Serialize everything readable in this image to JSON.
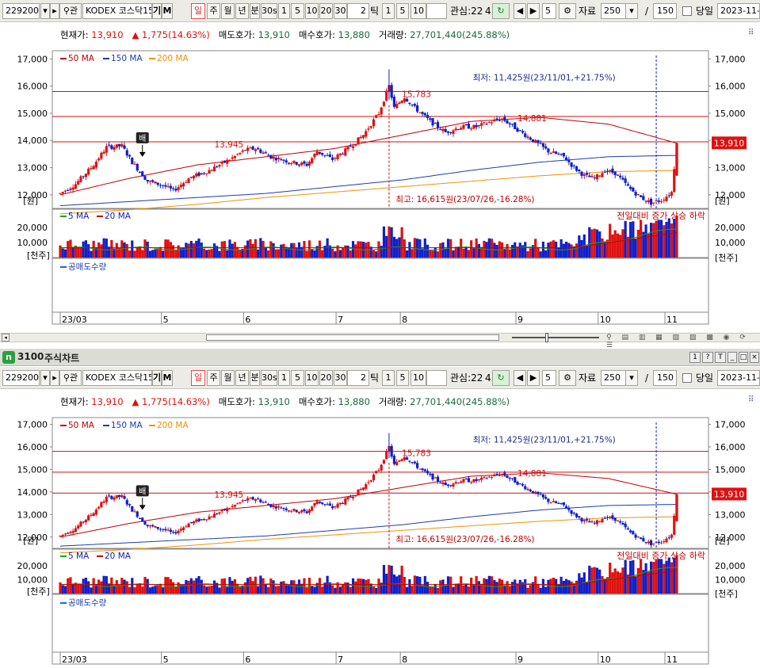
{
  "window": {
    "number": "3100",
    "title": "주식차트"
  },
  "toolbar": {
    "code": "229200",
    "search_icon": "search-icon",
    "name": "KODEX 코스닥15",
    "btn_gi": "기",
    "btn_m": "M",
    "btn_fav": "관",
    "periods": [
      "일",
      "주",
      "월",
      "년",
      "분",
      "30s",
      "1",
      "5",
      "10",
      "20",
      "30"
    ],
    "tick_value": "2",
    "tick_label": "틱",
    "tick_units": [
      "1",
      "5",
      "10"
    ],
    "interest_label": "관심:22",
    "interest_value": "4",
    "step_value": "5",
    "data_label": "자료",
    "data_count": "250",
    "slash": "/",
    "max_count": "150",
    "today_label": "당일",
    "date": "2023-11-0"
  },
  "info": {
    "price_label": "현재가:",
    "price": "13,910",
    "change": "1,775(14.63%)",
    "ask_label": "매도호가:",
    "ask": "13,910",
    "bid_label": "매수호가:",
    "bid": "13,880",
    "volume_label": "거래량:",
    "volume": "27,701,440(245.88%)"
  },
  "legend": {
    "ma50": "50 MA",
    "ma150": "150 MA",
    "ma200": "200 MA",
    "vol_ma5": "5 MA",
    "vol_ma20": "20 MA",
    "short_sell": "공매도수량",
    "prev_compare": "전일대비 증가 상승 하락"
  },
  "annotations": {
    "low": "최저: 11,425원(23/11/01,+21.75%)",
    "high": "최고: 16,615원(23/07/26,-16.28%)",
    "lbl_15783": "15,783",
    "lbl_14881": "14,881",
    "lbl_13945": "13,945",
    "badge": "배",
    "current_tag": "13,910",
    "unit_won": "[원]",
    "unit_vol": "[천주]"
  },
  "price_axis": [
    "17,000",
    "16,000",
    "15,000",
    "14,000",
    "13,000",
    "12,000"
  ],
  "volume_axis": [
    "20,000",
    "10,000"
  ],
  "x_axis": [
    "23/03",
    "5",
    "6",
    "7",
    "8",
    "9",
    "10",
    "11"
  ],
  "colors": {
    "up": "#e01010",
    "down": "#1020c8",
    "ma50": "#c00000",
    "ma150": "#1a3cb0",
    "ma200": "#f09000",
    "vol_ma5": "#20a020",
    "hline": "#d01010"
  },
  "chart_data": {
    "type": "line",
    "series": [
      {
        "name": "50 MA",
        "values": [
          12000,
          12600,
          13100,
          13400,
          13700,
          14200,
          14700,
          14850,
          14600,
          13900
        ]
      },
      {
        "name": "150 MA",
        "values": [
          11600,
          11750,
          11900,
          12050,
          12300,
          12550,
          12900,
          13200,
          13400,
          13450
        ]
      },
      {
        "name": "200 MA",
        "values": [
          11300,
          11450,
          11650,
          11900,
          12100,
          12300,
          12500,
          12700,
          12850,
          12900
        ]
      }
    ],
    "ylim": [
      11500,
      17300
    ]
  }
}
